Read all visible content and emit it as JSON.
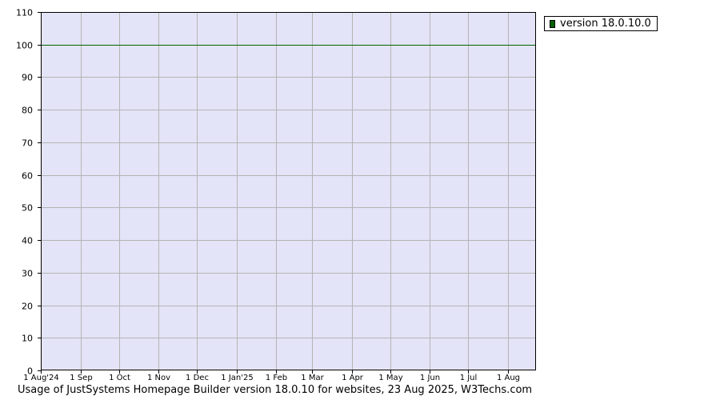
{
  "chart_data": {
    "type": "line",
    "title": "",
    "xlabel": "",
    "ylabel": "",
    "ylim": [
      0,
      110
    ],
    "yticks": [
      0,
      10,
      20,
      30,
      40,
      50,
      60,
      70,
      80,
      90,
      100,
      110
    ],
    "x_tick_labels": [
      "1 Aug'24",
      "1 Sep",
      "1 Oct",
      "1 Nov",
      "1 Dec",
      "1 Jan'25",
      "1 Feb",
      "1 Mar",
      "1 Apr",
      "1 May",
      "1 Jun",
      "1 Jul",
      "1 Aug"
    ],
    "x_tick_dates": [
      "2024-08-01",
      "2024-09-01",
      "2024-10-01",
      "2024-11-01",
      "2024-12-01",
      "2025-01-01",
      "2025-02-01",
      "2025-03-01",
      "2025-04-01",
      "2025-05-01",
      "2025-06-01",
      "2025-07-01",
      "2025-08-01"
    ],
    "xlim": [
      "2024-08-01",
      "2025-08-23"
    ],
    "grid": true,
    "plot_background": "#e4e4f8",
    "grid_color": "#b4b4b4",
    "legend_position": "top-right, outside plot",
    "series": [
      {
        "name": "version 18.0.10.0",
        "color": "#006400",
        "x": [
          "2024-08-01",
          "2025-08-23"
        ],
        "y": [
          100,
          100
        ]
      }
    ]
  },
  "legend": {
    "entries": [
      {
        "label": "version 18.0.10.0",
        "color": "#006400"
      }
    ]
  },
  "caption": "Usage of JustSystems Homepage Builder version 18.0.10 for websites, 23 Aug 2025, W3Techs.com"
}
